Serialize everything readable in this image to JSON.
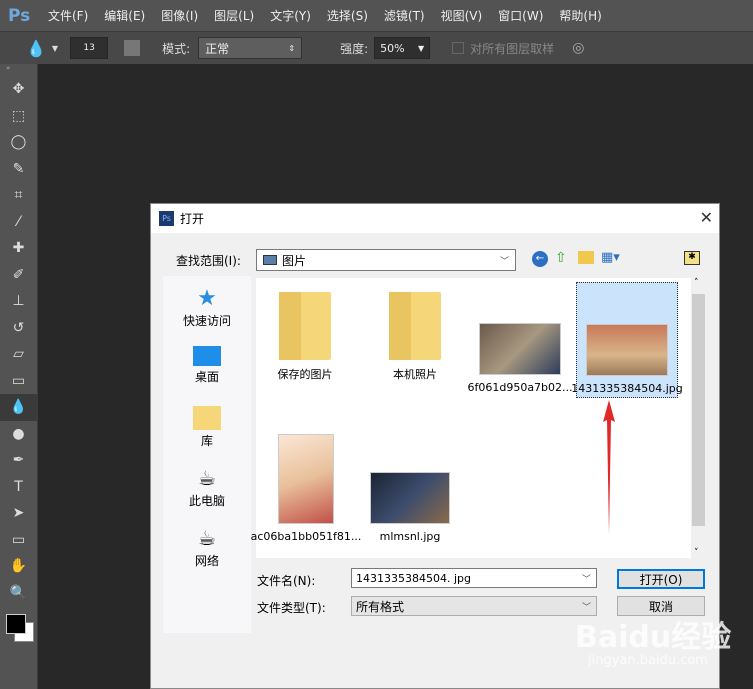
{
  "app": {
    "logo": "Ps"
  },
  "menu": [
    "文件(F)",
    "编辑(E)",
    "图像(I)",
    "图层(L)",
    "文字(Y)",
    "选择(S)",
    "滤镜(T)",
    "视图(V)",
    "窗口(W)",
    "帮助(H)"
  ],
  "options": {
    "brush_size": "13",
    "mode_label": "模式:",
    "mode_value": "正常",
    "strength_label": "强度:",
    "strength_value": "50%",
    "sample_all_label": "对所有图层取样"
  },
  "dialog": {
    "title": "打开",
    "lookin_label": "查找范围(I):",
    "lookin_value": "图片",
    "nav": [
      {
        "label": "快速访问"
      },
      {
        "label": "桌面"
      },
      {
        "label": "库"
      },
      {
        "label": "此电脑"
      },
      {
        "label": "网络"
      }
    ],
    "files": [
      {
        "name": "保存的图片"
      },
      {
        "name": "本机照片"
      },
      {
        "name": "6f061d950a7b02..."
      },
      {
        "name": "1431335384504.jpg"
      },
      {
        "name": "ac06ba1bb051f81..."
      },
      {
        "name": "mlmsnl.jpg"
      }
    ],
    "filename_label": "文件名(N):",
    "filename_value": "1431335384504. jpg",
    "filetype_label": "文件类型(T):",
    "filetype_value": "所有格式",
    "open_button": "打开(O)",
    "cancel_button": "取消"
  },
  "watermark": {
    "brand": "Baidu经验",
    "url": "jingyan.baidu.com"
  }
}
